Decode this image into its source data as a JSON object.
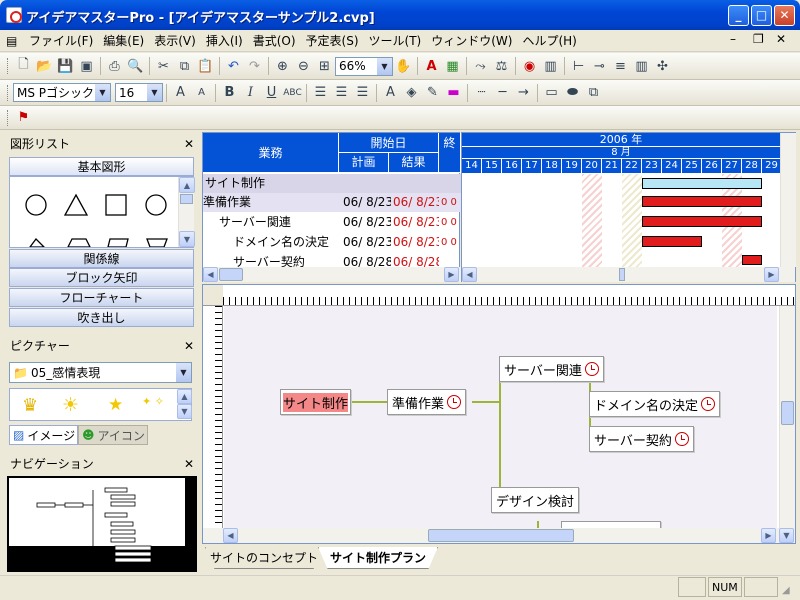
{
  "window": {
    "title": "アイデアマスターPro - [アイデアマスターサンプル2.cvp]"
  },
  "menu": [
    "ファイル(F)",
    "編集(E)",
    "表示(V)",
    "挿入(I)",
    "書式(O)",
    "予定表(S)",
    "ツール(T)",
    "ウィンドウ(W)",
    "ヘルプ(H)"
  ],
  "toolbar": {
    "zoom": "66%",
    "font": "MS Pゴシック",
    "size": "16"
  },
  "left": {
    "shapes_title": "図形リスト",
    "categories": [
      "基本図形",
      "関係線",
      "ブロック矢印",
      "フローチャート",
      "吹き出し"
    ],
    "picture_title": "ピクチャー",
    "picture_select": "05_感情表現",
    "tab_image": "イメージ",
    "tab_icon": "アイコン",
    "nav_title": "ナビゲーション"
  },
  "gantt": {
    "col_task": "業務",
    "col_start": "開始日",
    "col_plan": "計画",
    "col_result": "結果",
    "col_end": "終",
    "year": "2006 年",
    "month": "8 月",
    "days": [
      "14",
      "15",
      "16",
      "17",
      "18",
      "19",
      "20",
      "21",
      "22",
      "23",
      "24",
      "25",
      "26",
      "27",
      "28",
      "29"
    ],
    "rows": [
      {
        "name": "サイト制作",
        "plan": "",
        "result": "",
        "e": ""
      },
      {
        "name": "準備作業",
        "plan": "06/ 8/23",
        "result": "06/ 8/23",
        "e": "0 0"
      },
      {
        "name": "サーバー関連",
        "plan": "06/ 8/23",
        "result": "06/ 8/23",
        "e": "0 0"
      },
      {
        "name": "ドメイン名の決定",
        "plan": "06/ 8/23",
        "result": "06/ 8/23",
        "e": "0 0"
      },
      {
        "name": "サーバー契約",
        "plan": "06/ 8/28",
        "result": "06/ 8/28",
        "e": "0 0"
      }
    ]
  },
  "map": {
    "root": "サイト制作",
    "n1": "準備作業",
    "n2": "サーバー関連",
    "n3": "ドメイン名の決定",
    "n4": "サーバー契約",
    "n5": "デザイン検討"
  },
  "tabs": [
    "サイトのコンセプト",
    "サイト制作プラン"
  ],
  "status": {
    "num": "NUM"
  }
}
